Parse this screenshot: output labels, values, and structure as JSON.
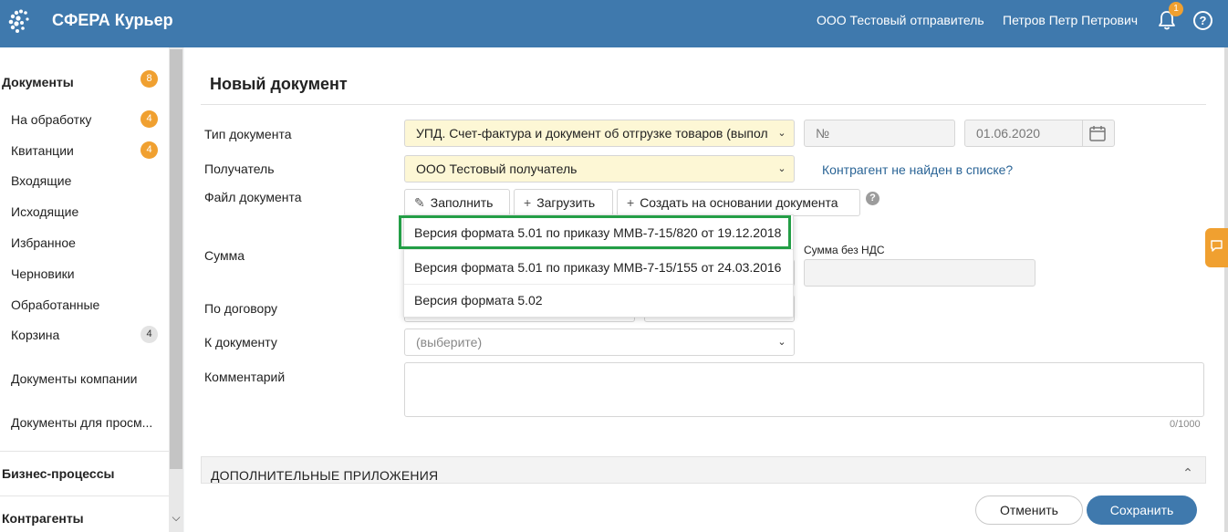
{
  "header": {
    "app_title": "СФЕРА Курьер",
    "organization": "ООО Тестовый отправитель",
    "user_name": "Петров Петр Петрович",
    "notification_count": "1",
    "help_symbol": "?"
  },
  "sidebar": {
    "documents_title": "Документы",
    "documents_count": "8",
    "items": [
      {
        "label": "На обработку",
        "badge": "4"
      },
      {
        "label": "Квитанции",
        "badge": "4"
      },
      {
        "label": "Входящие"
      },
      {
        "label": "Исходящие"
      },
      {
        "label": "Избранное"
      },
      {
        "label": "Черновики"
      },
      {
        "label": "Обработанные"
      },
      {
        "label": "Корзина",
        "badge": "4"
      }
    ],
    "company_documents": "Документы компании",
    "view_documents": "Документы для просм...",
    "business_processes": "Бизнес-процессы",
    "contractors": "Контрагенты"
  },
  "form": {
    "page_title": "Новый документ",
    "doc_type_label": "Тип документа",
    "doc_type_value": "УПД. Счет-фактура и документ об отгрузке товаров (выпол",
    "number_placeholder": "№",
    "date_value": "01.06.2020",
    "recipient_label": "Получатель",
    "recipient_value": "ООО Тестовый получатель",
    "contractor_not_found_link": "Контрагент не найден в списке?",
    "file_label": "Файл документа",
    "fill_button": "Заполнить",
    "upload_button": "Загрузить",
    "create_based_button": "Создать на основании документа",
    "sum_label": "Сумма",
    "sum_without_vat_label": "Сумма без НДС",
    "contract_label": "По договору",
    "to_document_label": "К документу",
    "to_document_placeholder": "(выберите)",
    "comment_label": "Комментарий",
    "comment_counter": "0/1000",
    "additional_attachments": "ДОПОЛНИТЕЛЬНЫЕ ПРИЛОЖЕНИЯ",
    "cancel_button": "Отменить",
    "save_button": "Сохранить"
  },
  "format_dropdown": {
    "options": [
      "Версия формата 5.01 по приказу ММВ-7-15/820 от 19.12.2018",
      "Версия формата 5.01 по приказу ММВ-7-15/155 от 24.03.2016",
      "Версия формата 5.02"
    ],
    "highlighted_index": 0
  },
  "colors": {
    "header_bg": "#3f79ad",
    "badge_orange": "#f0a030",
    "highlight_green": "#239e46",
    "required_field_yellow": "#fdf7d5",
    "link_blue": "#2a6496"
  }
}
